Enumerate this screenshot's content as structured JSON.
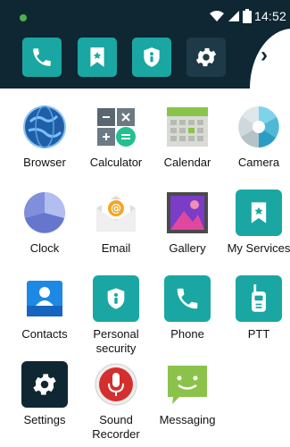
{
  "status_bar": {
    "time": "14:52",
    "icons": [
      "notification-dot-icon",
      "wifi-icon",
      "signal-icon",
      "battery-icon"
    ]
  },
  "dock": {
    "items": [
      {
        "name": "phone-icon"
      },
      {
        "name": "my-services-bookmark-icon"
      },
      {
        "name": "personal-security-icon"
      },
      {
        "name": "settings-gear-icon"
      }
    ],
    "next_icon": "chevron-right-icon",
    "next_glyph": "›"
  },
  "apps": [
    {
      "label": "Browser",
      "icon": "globe-icon"
    },
    {
      "label": "Calculator",
      "icon": "calculator-icon"
    },
    {
      "label": "Calendar",
      "icon": "calendar-icon"
    },
    {
      "label": "Camera",
      "icon": "camera-icon"
    },
    {
      "label": "Clock",
      "icon": "clock-icon"
    },
    {
      "label": "Email",
      "icon": "email-icon"
    },
    {
      "label": "Gallery",
      "icon": "gallery-icon"
    },
    {
      "label": "My Services",
      "icon": "bookmark-icon"
    },
    {
      "label": "Contacts",
      "icon": "contacts-icon"
    },
    {
      "label": "Personal security",
      "label_line1": "Personal",
      "label_line2": "security",
      "icon": "security-shield-icon"
    },
    {
      "label": "Phone",
      "icon": "phone-icon"
    },
    {
      "label": "PTT",
      "icon": "walkie-talkie-icon"
    },
    {
      "label": "Settings",
      "icon": "gear-icon"
    },
    {
      "label": "Sound Recorder",
      "label_line1": "Sound",
      "label_line2": "Recorder",
      "icon": "microphone-icon"
    },
    {
      "label": "Messaging",
      "icon": "message-icon"
    }
  ],
  "colors": {
    "bar": "#0f2733",
    "teal": "#1aa7a3",
    "teal_dark": "#157f80",
    "accent_green": "#4caf50"
  }
}
